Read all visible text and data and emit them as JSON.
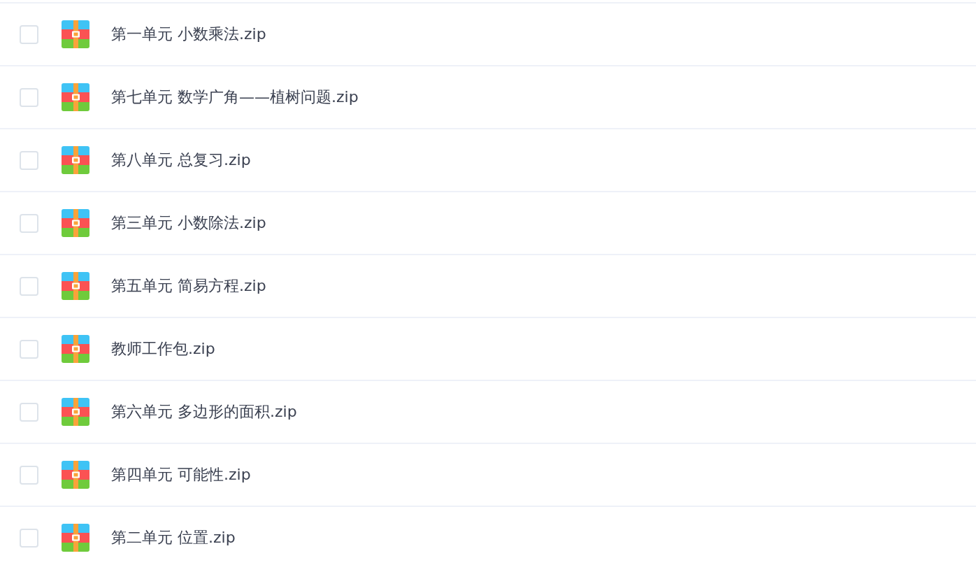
{
  "files": [
    {
      "name": "第一单元 小数乘法.zip",
      "checked": false
    },
    {
      "name": "第七单元 数学广角——植树问题.zip",
      "checked": false
    },
    {
      "name": "第八单元 总复习.zip",
      "checked": false
    },
    {
      "name": "第三单元 小数除法.zip",
      "checked": false
    },
    {
      "name": "第五单元 简易方程.zip",
      "checked": false
    },
    {
      "name": "教师工作包.zip",
      "checked": false
    },
    {
      "name": "第六单元 多边形的面积.zip",
      "checked": false
    },
    {
      "name": "第四单元 可能性.zip",
      "checked": false
    },
    {
      "name": "第二单元 位置.zip",
      "checked": false
    }
  ]
}
